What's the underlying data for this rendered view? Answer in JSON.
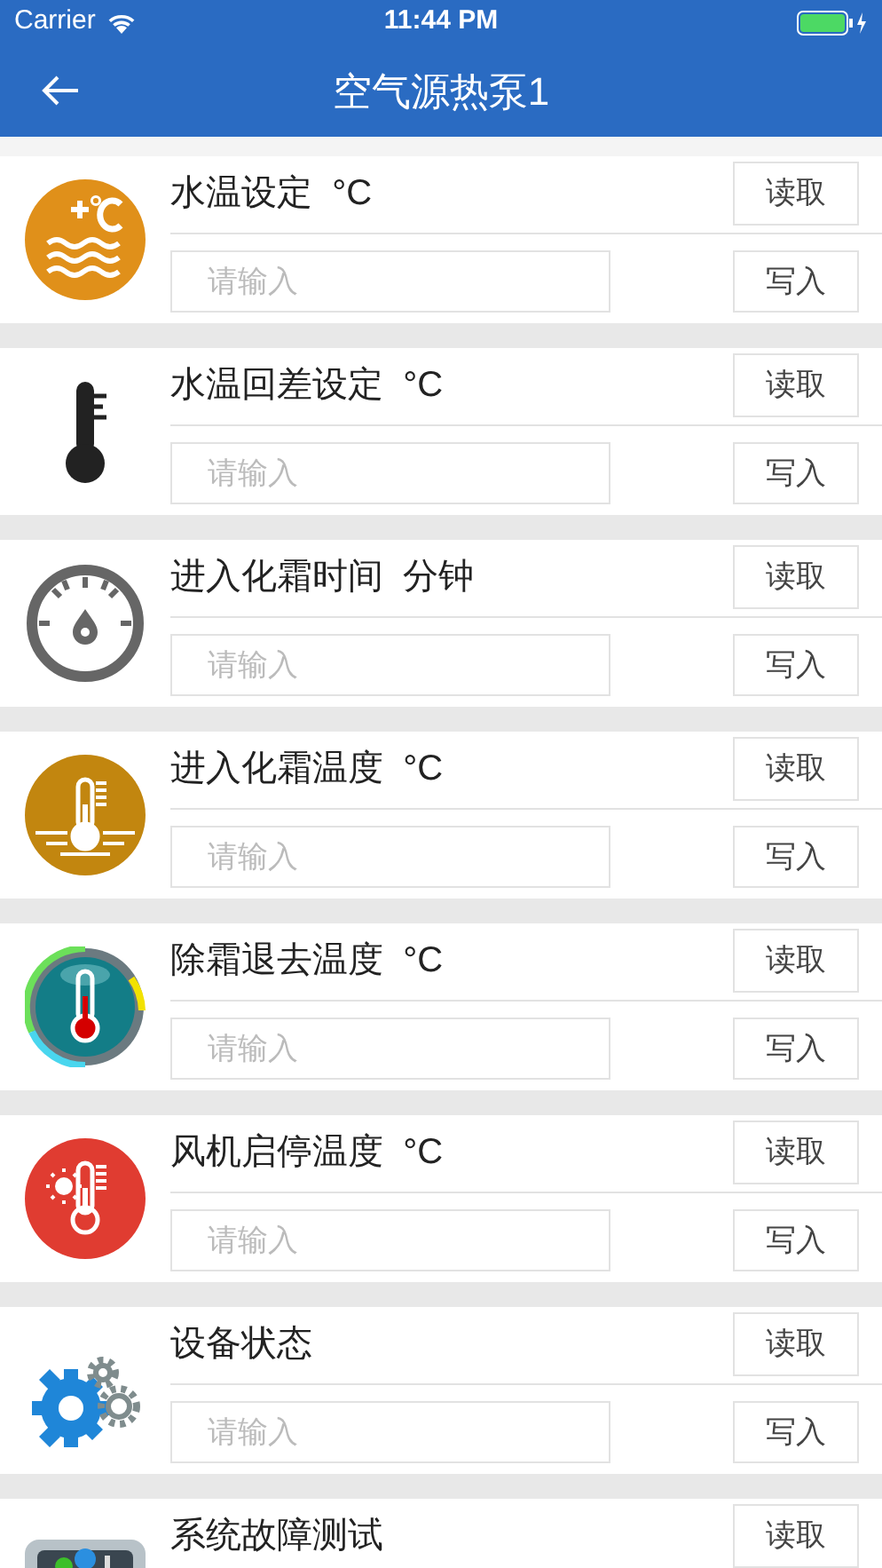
{
  "status_bar": {
    "carrier": "Carrier",
    "time": "11:44 PM"
  },
  "nav_bar": {
    "title": "空气源热泵1"
  },
  "items": [
    {
      "title": "水温设定  °C",
      "read_button": "读取",
      "placeholder": "请输入",
      "write_button": "写入"
    },
    {
      "title": "水温回差设定  °C",
      "read_button": "读取",
      "placeholder": "请输入",
      "write_button": "写入"
    },
    {
      "title": "进入化霜时间  分钟",
      "read_button": "读取",
      "placeholder": "请输入",
      "write_button": "写入"
    },
    {
      "title": "进入化霜温度  °C",
      "read_button": "读取",
      "placeholder": "请输入",
      "write_button": "写入"
    },
    {
      "title": "除霜退去温度  °C",
      "read_button": "读取",
      "placeholder": "请输入",
      "write_button": "写入"
    },
    {
      "title": "风机启停温度  °C",
      "read_button": "读取",
      "placeholder": "请输入",
      "write_button": "写入"
    },
    {
      "title": "设备状态",
      "read_button": "读取",
      "placeholder": "请输入",
      "write_button": "写入"
    },
    {
      "title": "系统故障测试",
      "read_button": "读取"
    }
  ]
}
